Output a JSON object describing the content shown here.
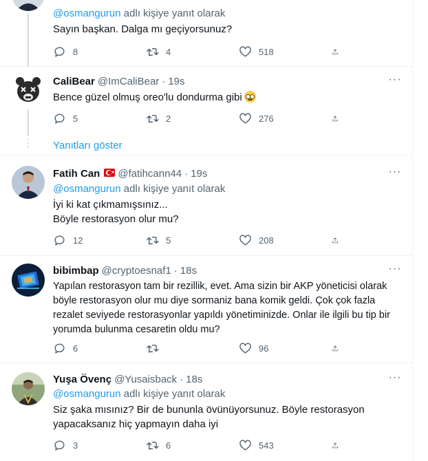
{
  "colors": {
    "accent": "#1d9bf0",
    "secondary_text": "#536471",
    "border": "#eff3f4"
  },
  "reply_to_suffix": "adlı kişiye yanıt olarak",
  "show_replies_label": "Yanıtları göster",
  "tweets": [
    {
      "reply_mention": "@osmangurun",
      "text_lines": [
        "Sayın başkan. Dalga mı geçiyorsunuz?"
      ],
      "replies": "8",
      "retweets": "4",
      "likes": "518"
    },
    {
      "name": "CaliBear",
      "handle": "@ImCaliBear",
      "time": "19s",
      "text_lines": [
        "Bence güzel olmuş oreo'lu dondurma gibi"
      ],
      "emoji": "nerd-face-emoji",
      "replies": "5",
      "retweets": "2",
      "likes": "276"
    },
    {
      "name": "Fatih Can",
      "handle": "@fatihcann44",
      "time": "19s",
      "flag": "turkey-flag-icon",
      "reply_mention": "@osmangurun",
      "text_lines": [
        "İyi ki kat çıkmamışsınız...",
        "Böyle restorasyon olur mu?"
      ],
      "replies": "12",
      "retweets": "5",
      "likes": "208"
    },
    {
      "name": "bibimbap",
      "handle": "@cryptoesnaf1",
      "time": "18s",
      "text_lines": [
        "Yapılan restorasyon tam bir rezillik, evet. Ama sizin bir AKP yöneticisi olarak",
        "böyle restorasyon olur mu diye sormaniz bana komik geldi. Çok çok fazla",
        "rezalet seviyede restorasyonlar yapıldı yönetiminizde. Onlar ile ilgili bu tip bir",
        "yorumda bulunma cesaretin oldu mu?"
      ],
      "replies": "6",
      "retweets": "",
      "likes": "96"
    },
    {
      "name": "Yuşa Övenç",
      "handle": "@Yusaisback",
      "time": "18s",
      "reply_mention": "@osmangurun",
      "text_lines": [
        "Siz şaka mısınız? Bir de bununla övünüyorsunuz. Böyle restorasyon",
        "yapacaksanız hiç yapmayın daha iyi"
      ],
      "replies": "3",
      "retweets": "6",
      "likes": "543"
    }
  ]
}
